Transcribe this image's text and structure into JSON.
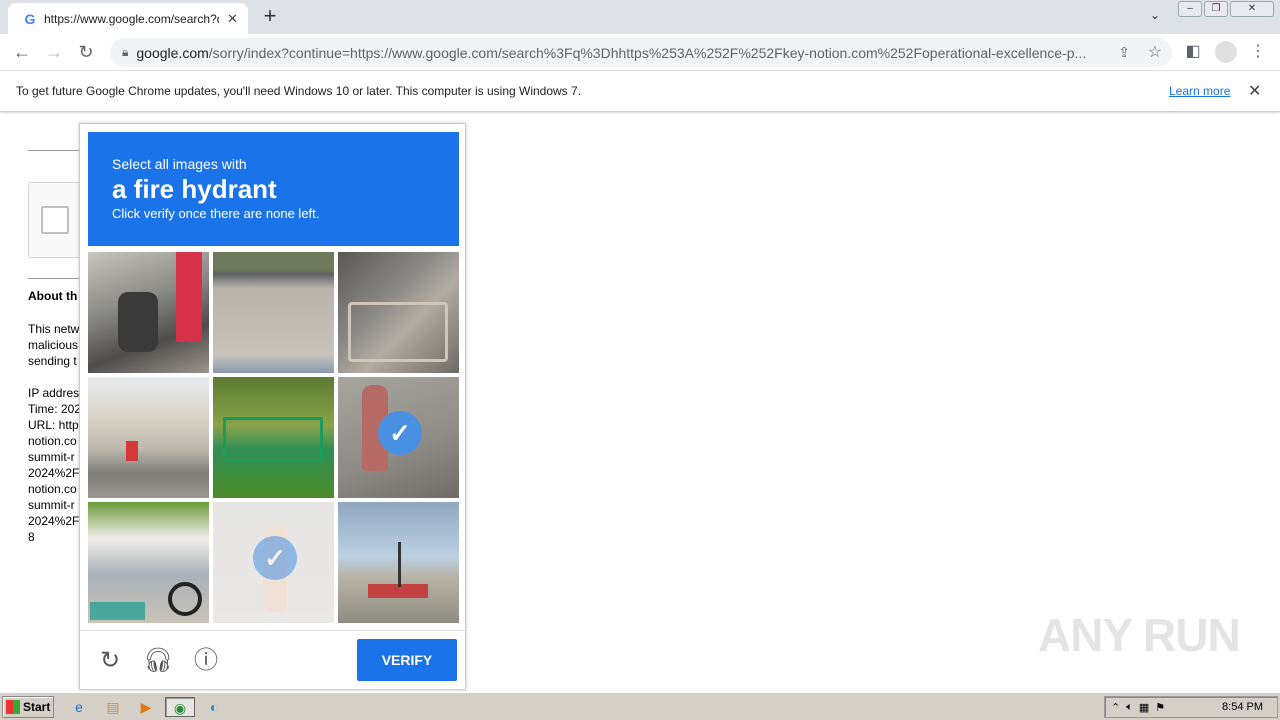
{
  "browser": {
    "tab_title": "https://www.google.com/search?q=",
    "tab_favicon": "G",
    "url_host": "google.com",
    "url_rest": "/sorry/index?continue=https://www.google.com/search%3Fq%3Dhhttps%253A%252F%252Fkey-notion.com%252Foperational-excellence-p..."
  },
  "infobar": {
    "message": "To get future Google Chrome updates, you'll need Windows 10 or later. This computer is using Windows 7.",
    "learn_more": "Learn more"
  },
  "page": {
    "about_heading": "About th",
    "lines": [
      "This netw",
      "malicious",
      "sending t",
      "",
      "IP addres",
      "Time: 202",
      "URL: http",
      "notion.co",
      "summit-r",
      "2024%2F",
      "notion.co",
      "summit-r",
      "2024%2F",
      "8"
    ]
  },
  "challenge": {
    "line1": "Select all images with",
    "target": "a fire hydrant",
    "line3": "Click verify once there are none left.",
    "verify_label": "VERIFY",
    "tiles": [
      {
        "name": "tile-scooters-sign",
        "selected": false
      },
      {
        "name": "tile-road-curb",
        "selected": false
      },
      {
        "name": "tile-bicycle-fence",
        "selected": false
      },
      {
        "name": "tile-street-buildings",
        "selected": false
      },
      {
        "name": "tile-green-fence",
        "selected": false
      },
      {
        "name": "tile-fire-hydrant",
        "selected": true
      },
      {
        "name": "tile-scooter-wall",
        "selected": false
      },
      {
        "name": "tile-faded-hydrant",
        "selected": true
      },
      {
        "name": "tile-intersection",
        "selected": false
      }
    ]
  },
  "watermark": "ANY RUN",
  "taskbar": {
    "start_label": "Start",
    "clock": "8:54 PM"
  }
}
